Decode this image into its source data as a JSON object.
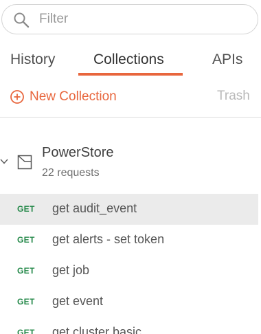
{
  "search": {
    "placeholder": "Filter",
    "icon": "search-icon"
  },
  "tabs": [
    {
      "label": "History",
      "active": false
    },
    {
      "label": "Collections",
      "active": true
    },
    {
      "label": "APIs",
      "active": false
    }
  ],
  "toolbar": {
    "new_collection_label": "New Collection",
    "trash_label": "Trash"
  },
  "colors": {
    "accent": "#e8663d",
    "get_method": "#25894a",
    "selected_row": "#ebebeb"
  },
  "collection": {
    "name": "PowerStore",
    "count": "22 requests",
    "expanded": true,
    "requests": [
      {
        "method": "GET",
        "name": "get audit_event",
        "selected": true
      },
      {
        "method": "GET",
        "name": "get alerts - set token",
        "selected": false
      },
      {
        "method": "GET",
        "name": "get job",
        "selected": false
      },
      {
        "method": "GET",
        "name": "get event",
        "selected": false
      },
      {
        "method": "GET",
        "name": "get cluster basic",
        "selected": false
      }
    ]
  }
}
